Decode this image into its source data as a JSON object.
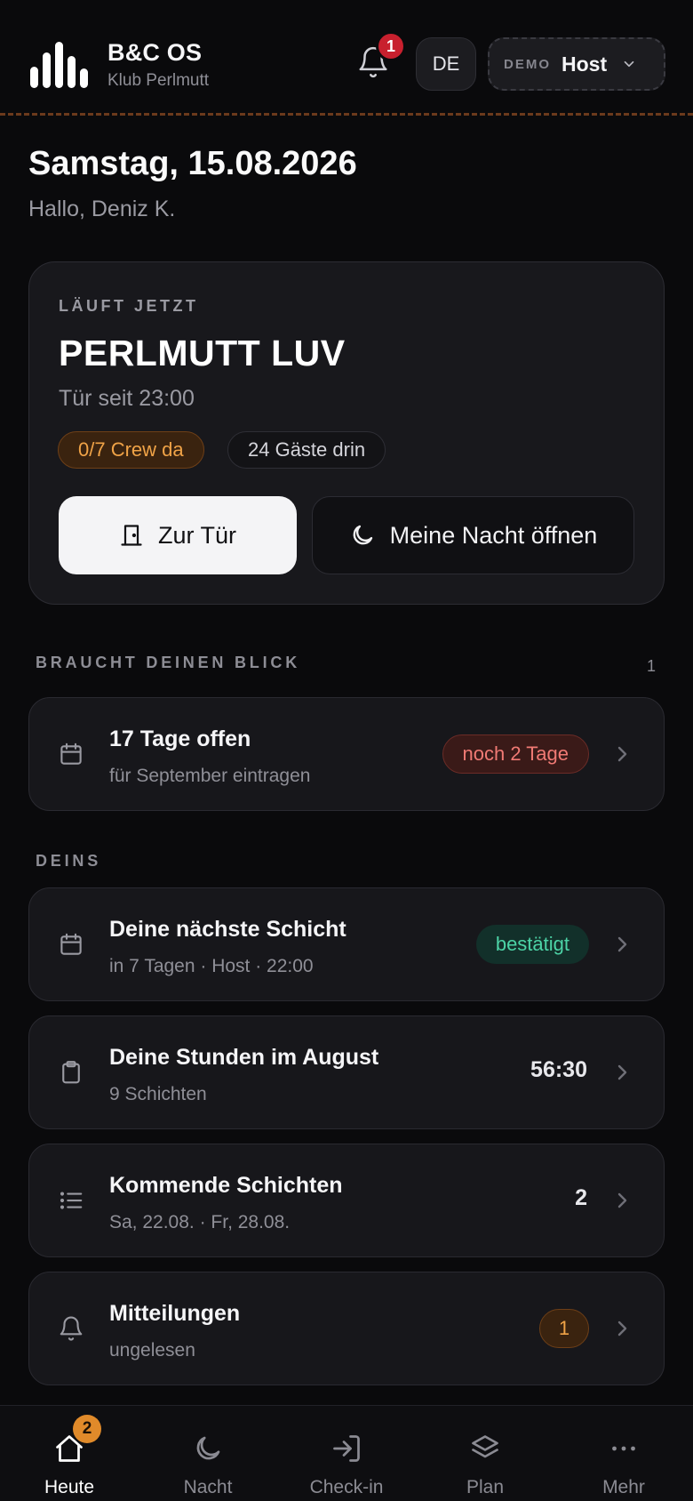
{
  "header": {
    "brand_title": "B&C OS",
    "brand_subtitle": "Klub Perlmutt",
    "notification_count": "1",
    "language": "DE",
    "role_mode": "DEMO",
    "role_name": "Host"
  },
  "date": {
    "title": "Samstag, 15.08.2026",
    "greeting": "Hallo, Deniz K."
  },
  "now": {
    "label": "LÄUFT JETZT",
    "title": "PERLMUTT LUV",
    "subtitle": "Tür seit 23:00",
    "crew_pill": "0/7 Crew da",
    "guests_pill": "24 Gäste drin",
    "door_button": "Zur Tür",
    "night_button": "Meine Nacht öffnen"
  },
  "attention": {
    "label": "BRAUCHT DEINEN BLICK",
    "count": "1",
    "items": [
      {
        "title": "17 Tage offen",
        "subtitle": "für September eintragen",
        "tag": "noch 2 Tage",
        "icon": "calendar-icon"
      }
    ]
  },
  "mine": {
    "label": "DEINS",
    "items": [
      {
        "title": "Deine nächste Schicht",
        "subtitle": "in 7 Tagen · Host · 22:00",
        "tag": "bestätigt",
        "icon": "calendar-icon"
      },
      {
        "title": "Deine Stunden im August",
        "subtitle": "9 Schichten",
        "value": "56:30",
        "icon": "clipboard-icon"
      },
      {
        "title": "Kommende Schichten",
        "subtitle": "Sa, 22.08. · Fr, 28.08.",
        "value": "2",
        "icon": "list-icon"
      },
      {
        "title": "Mitteilungen",
        "subtitle": "ungelesen",
        "tag": "1",
        "icon": "bell-icon"
      }
    ]
  },
  "nav": {
    "items": [
      {
        "label": "Heute",
        "icon": "home-icon",
        "badge": "2",
        "active": true
      },
      {
        "label": "Nacht",
        "icon": "moon-icon"
      },
      {
        "label": "Check-in",
        "icon": "login-icon"
      },
      {
        "label": "Plan",
        "icon": "layers-icon"
      },
      {
        "label": "Mehr",
        "icon": "more-icon"
      }
    ]
  },
  "colors": {
    "background": "#0a0a0c",
    "card": "#18181c",
    "accent_orange": "#f0a347",
    "warn_red": "#f07a74",
    "ok_green": "#4cd3a6",
    "badge_red": "#c8202e"
  }
}
